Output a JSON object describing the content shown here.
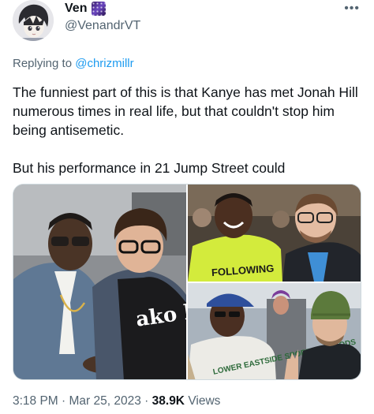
{
  "author": {
    "display_name": "Ven",
    "handle": "@VenandrVT",
    "badge_icon": "galaxy-emoji-icon",
    "avatar_icon": "anime-avatar-icon"
  },
  "more_label": "•••",
  "reply": {
    "prefix": "Replying to ",
    "mention": "@chrizmillr"
  },
  "tweet": {
    "paragraphs": [
      "The funniest part of this is that Kanye has met Jonah Hill numerous times in real life, but that couldn't stop him being antisemetic.",
      "But his performance in 21 Jump Street could"
    ]
  },
  "media": {
    "photo_1_shirt_text": "ako hig la so",
    "photo_2_shirt_text": "FOLLOWING",
    "photo_3_shirt_text": "LOWER EASTSIDE SPORTING GOODS"
  },
  "meta": {
    "time": "3:18 PM",
    "sep": " · ",
    "date": "Mar 25, 2023",
    "views_count": "38.9K",
    "views_label": " Views"
  },
  "colors": {
    "text": "#0f1419",
    "muted": "#536471",
    "link": "#1d9bf0",
    "border": "#cfd9de"
  }
}
